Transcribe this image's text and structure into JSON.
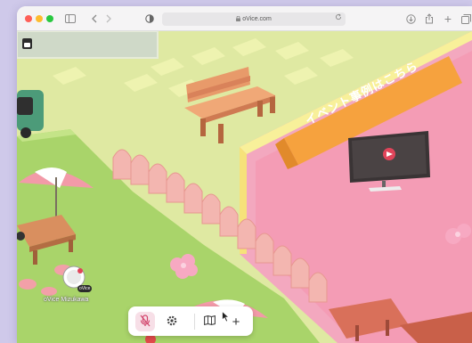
{
  "browser": {
    "url": "oVice.com",
    "icons": [
      "sidebar-icon",
      "back-icon",
      "forward-icon",
      "privacy-icon",
      "lock-icon",
      "reload-icon",
      "download-icon",
      "share-icon",
      "new-tab-icon",
      "tabs-icon"
    ]
  },
  "space": {
    "banner_text": "イベント事例はこちら",
    "avatar_name": "oVice Mizukawa",
    "avatar_badge": "oVice"
  },
  "bottom_bar": {
    "buttons": [
      {
        "name": "microphone-muted-button",
        "icon": "mic-off-icon"
      },
      {
        "name": "settings-button",
        "icon": "gear-icon"
      },
      {
        "name": "map-button",
        "icon": "map-icon"
      },
      {
        "name": "add-button",
        "icon": "plus-icon",
        "label": "+"
      }
    ]
  },
  "colors": {
    "background": "#cfc9ea",
    "grass": "#d9e89a",
    "lawn": "#a9d46a",
    "stage": "#f3a8bf",
    "banner": "#f6a23e",
    "mic_active": "#f7dfe7"
  }
}
